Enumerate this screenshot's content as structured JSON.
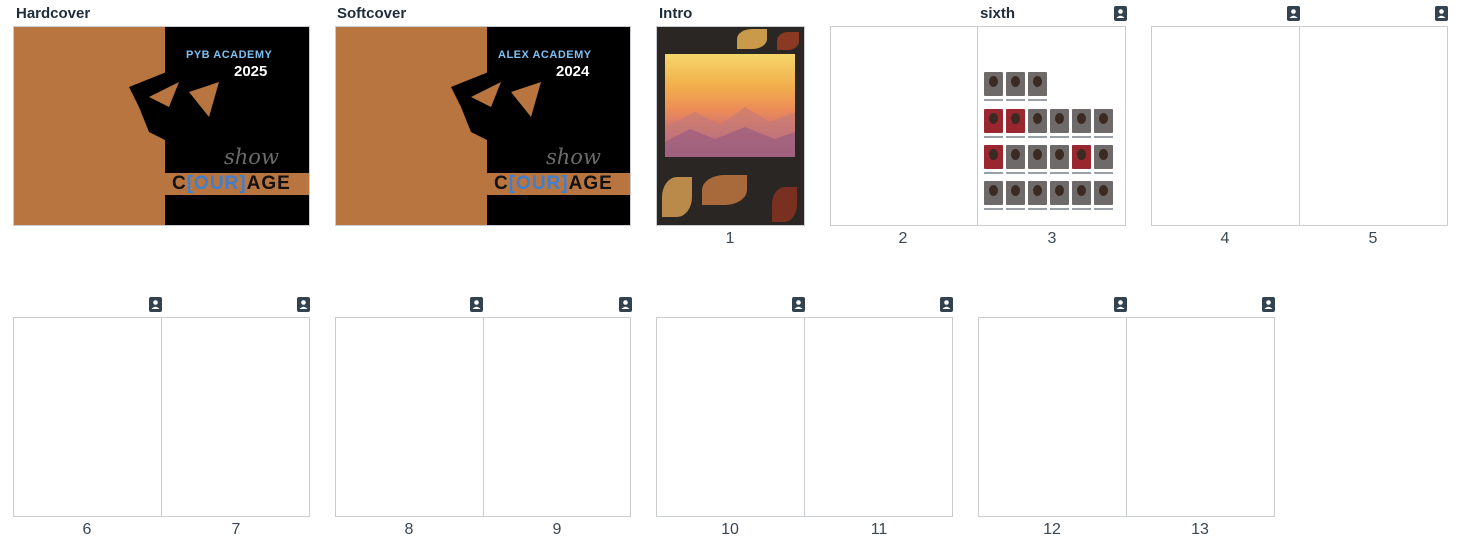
{
  "sections": {
    "hardcover": "Hardcover",
    "softcover": "Softcover",
    "intro": "Intro",
    "sixth": "sixth"
  },
  "covers": {
    "hardcover": {
      "school": "PYB ACADEMY",
      "year": "2025",
      "script": "show",
      "word_start": "C",
      "word_mid": "[OUR]",
      "word_end": "AGE"
    },
    "softcover": {
      "school": "ALEX ACADEMY",
      "year": "2024",
      "script": "show",
      "word_start": "C",
      "word_mid": "[OUR]",
      "word_end": "AGE"
    }
  },
  "page_numbers": [
    "1",
    "2",
    "3",
    "4",
    "5",
    "6",
    "7",
    "8",
    "9",
    "10",
    "11",
    "12",
    "13"
  ],
  "icons": {
    "portrait_badge": "person-icon"
  },
  "colors": {
    "cover_orange": "#b8753f",
    "accent_blue": "#3d7fd0",
    "badge_dark": "#33424f"
  }
}
